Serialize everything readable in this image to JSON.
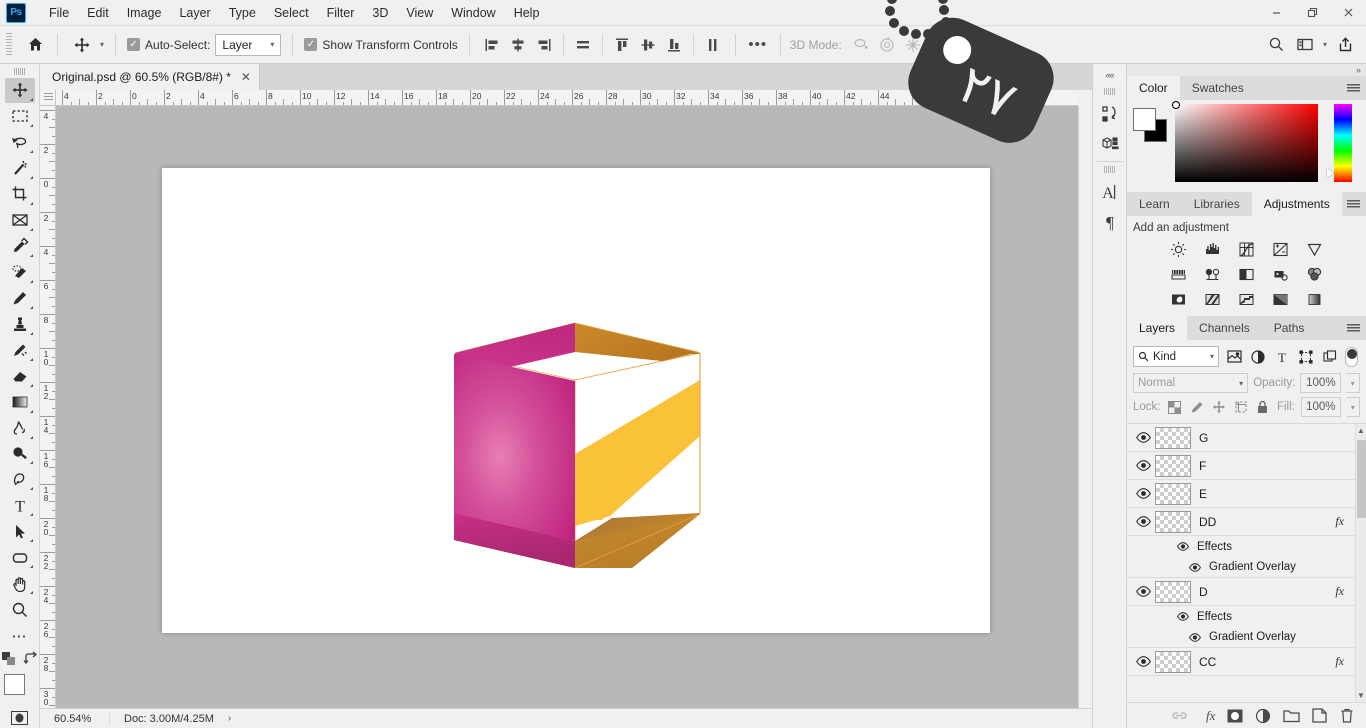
{
  "app": {
    "name": "Ps",
    "menus": [
      "File",
      "Edit",
      "Image",
      "Layer",
      "Type",
      "Select",
      "Filter",
      "3D",
      "View",
      "Window",
      "Help"
    ],
    "window_controls": {
      "minimize": "–",
      "restore": "❐",
      "close": "✕"
    }
  },
  "options_bar": {
    "home_icon": "home-icon",
    "tool_icon": "move-tool-icon",
    "auto_select_label": "Auto-Select:",
    "auto_select_checked": true,
    "auto_select_value": "Layer",
    "show_transform_label": "Show Transform Controls",
    "show_transform_checked": true,
    "align_icons": [
      "align-left-edges",
      "align-horizontal-centers",
      "align-right-edges",
      "distribute-horizontally"
    ],
    "align_icons2": [
      "align-top-edges",
      "align-vertical-centers",
      "align-bottom-edges",
      "distribute-vertically"
    ],
    "more_label": "•••",
    "mode3d_label": "3D Mode:",
    "mode3d_icons": [
      "orbit-3d-icon",
      "roll-3d-icon",
      "pan-3d-icon",
      "slide-3d-icon",
      "zoom-camera-3d-icon"
    ],
    "right_icons": [
      "search-icon",
      "workspace-icon",
      "chevron-down-icon",
      "share-icon"
    ]
  },
  "toolbar": {
    "tools": [
      {
        "name": "move-tool",
        "active": true
      },
      {
        "name": "rectangular-marquee-tool",
        "active": false
      },
      {
        "name": "lasso-tool",
        "active": false
      },
      {
        "name": "magic-wand-tool",
        "active": false
      },
      {
        "name": "crop-tool",
        "active": false
      },
      {
        "name": "frame-tool",
        "active": false
      },
      {
        "name": "eyedropper-tool",
        "active": false
      },
      {
        "name": "spot-healing-brush-tool",
        "active": false
      },
      {
        "name": "brush-tool",
        "active": false
      },
      {
        "name": "clone-stamp-tool",
        "active": false
      },
      {
        "name": "history-brush-tool",
        "active": false
      },
      {
        "name": "eraser-tool",
        "active": false
      },
      {
        "name": "gradient-tool",
        "active": false
      },
      {
        "name": "blur-tool",
        "active": false
      },
      {
        "name": "dodge-tool",
        "active": false
      },
      {
        "name": "pen-tool",
        "active": false
      },
      {
        "name": "type-tool",
        "active": false
      },
      {
        "name": "path-selection-tool",
        "active": false
      },
      {
        "name": "rectangle-tool",
        "active": false
      },
      {
        "name": "hand-tool",
        "active": false
      },
      {
        "name": "zoom-tool",
        "active": false
      },
      {
        "name": "edit-toolbar-more",
        "active": false
      }
    ],
    "foreground_color": "#ffffff",
    "background_color": "#000000"
  },
  "document": {
    "tab_title": "Original.psd @ 60.5% (RGB/8#) *",
    "close_label": "✕",
    "ruler_h_labels": [
      "4",
      "2",
      "0",
      "2",
      "4",
      "6",
      "8",
      "10",
      "12",
      "14",
      "16",
      "18",
      "20",
      "22",
      "24",
      "26",
      "28",
      "30",
      "32",
      "34",
      "36",
      "38",
      "40",
      "42",
      "44",
      "46"
    ],
    "ruler_v_labels": [
      "4",
      "2",
      "0",
      "2",
      "4",
      "6",
      "8",
      "10",
      "12",
      "14",
      "16",
      "18",
      "20",
      "22",
      "24",
      "26",
      "28",
      "30"
    ]
  },
  "status_bar": {
    "zoom": "60.54%",
    "doc_info": "Doc: 3.00M/4.25M",
    "expand_arrow": "›"
  },
  "dock": {
    "collapse_icon": "««",
    "icons": [
      "history-panel-icon",
      "3d-panel-icon",
      "character-panel-icon",
      "paragraph-panel-icon"
    ]
  },
  "color_panel": {
    "tabs": [
      {
        "label": "Color",
        "active": true
      },
      {
        "label": "Swatches",
        "active": false
      }
    ],
    "menu_icon": "panel-menu-icon",
    "foreground_color": "#ffffff",
    "background_color": "#000000",
    "field_color": "#ff0000"
  },
  "adjustments_panel": {
    "tabs": [
      {
        "label": "Learn",
        "active": false
      },
      {
        "label": "Libraries",
        "active": false
      },
      {
        "label": "Adjustments",
        "active": true
      }
    ],
    "title": "Add an adjustment",
    "row1": [
      "brightness-contrast-icon",
      "levels-icon",
      "curves-icon",
      "exposure-icon",
      "vibrance-icon"
    ],
    "row2": [
      "color-balance-icon",
      "black-white-icon",
      "photo-filter-icon",
      "channel-mixer-icon",
      "color-lookup-icon"
    ],
    "row3": [
      "invert-icon",
      "posterize-icon",
      "threshold-icon",
      "gradient-map-icon",
      "selective-color-icon"
    ]
  },
  "layers_panel": {
    "tabs": [
      {
        "label": "Layers",
        "active": true
      },
      {
        "label": "Channels",
        "active": false
      },
      {
        "label": "Paths",
        "active": false
      }
    ],
    "filter_label": "Kind",
    "filter_icons": [
      "pixel-layers-filter-icon",
      "adjustment-layers-filter-icon",
      "type-layers-filter-icon",
      "shape-layers-filter-icon",
      "smart-object-filter-icon"
    ],
    "blend_mode": "Normal",
    "opacity_label": "Opacity:",
    "opacity_value": "100%",
    "lock_label": "Lock:",
    "lock_icons": [
      "lock-transparent-pixels-icon",
      "lock-image-pixels-icon",
      "lock-position-icon",
      "lock-artboard-icon",
      "lock-all-icon"
    ],
    "fill_label": "Fill:",
    "fill_value": "100%",
    "layers": [
      {
        "name": "G",
        "visible": true,
        "has_fx": false,
        "effects": []
      },
      {
        "name": "F",
        "visible": true,
        "has_fx": false,
        "effects": []
      },
      {
        "name": "E",
        "visible": true,
        "has_fx": false,
        "effects": []
      },
      {
        "name": "DD",
        "visible": true,
        "has_fx": true,
        "effects_label": "Effects",
        "effects": [
          "Gradient Overlay"
        ]
      },
      {
        "name": "D",
        "visible": true,
        "has_fx": true,
        "effects_label": "Effects",
        "effects": [
          "Gradient Overlay"
        ]
      },
      {
        "name": "CC",
        "visible": true,
        "has_fx": true,
        "effects": []
      }
    ],
    "fx_glyph": "fx",
    "footer_icons": [
      "link-layers-icon",
      "add-layer-style-icon",
      "add-layer-mask-icon",
      "new-adjustment-layer-icon",
      "new-group-icon",
      "new-layer-icon",
      "delete-layer-icon"
    ]
  },
  "overlay_tag": {
    "number": "٢٧"
  },
  "artwork": {
    "description": "isometric open cube logo",
    "colors": {
      "magenta": "#c9318b",
      "magenta_light": "#e06ba8",
      "gold": "#fac239",
      "orange": "#d4882a",
      "brown": "#a06a25",
      "white": "#ffffff",
      "outline": "#e8a33d"
    }
  }
}
